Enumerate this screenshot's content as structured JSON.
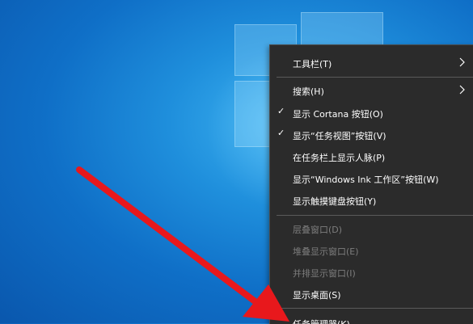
{
  "desktop": {
    "wallpaper_color": "#0f6fc7"
  },
  "context_menu": {
    "items": [
      {
        "label": "工具栏(T)",
        "checked": false,
        "submenu": true,
        "enabled": true
      },
      {
        "label": "搜索(H)",
        "checked": false,
        "submenu": true,
        "enabled": true
      },
      {
        "label": "显示 Cortana 按钮(O)",
        "checked": true,
        "submenu": false,
        "enabled": true
      },
      {
        "label": "显示“任务视图”按钮(V)",
        "checked": true,
        "submenu": false,
        "enabled": true
      },
      {
        "label": "在任务栏上显示人脉(P)",
        "checked": false,
        "submenu": false,
        "enabled": true
      },
      {
        "label": "显示“Windows Ink 工作区”按钮(W)",
        "checked": false,
        "submenu": false,
        "enabled": true
      },
      {
        "label": "显示触摸键盘按钮(Y)",
        "checked": false,
        "submenu": false,
        "enabled": true
      },
      {
        "label": "层叠窗口(D)",
        "checked": false,
        "submenu": false,
        "enabled": false
      },
      {
        "label": "堆叠显示窗口(E)",
        "checked": false,
        "submenu": false,
        "enabled": false
      },
      {
        "label": "并排显示窗口(I)",
        "checked": false,
        "submenu": false,
        "enabled": false
      },
      {
        "label": "显示桌面(S)",
        "checked": false,
        "submenu": false,
        "enabled": true
      },
      {
        "label": "任务管理器(K)",
        "checked": false,
        "submenu": false,
        "enabled": true
      }
    ],
    "check_glyph": "✓"
  },
  "annotation": {
    "arrow_color": "#e8181c"
  }
}
